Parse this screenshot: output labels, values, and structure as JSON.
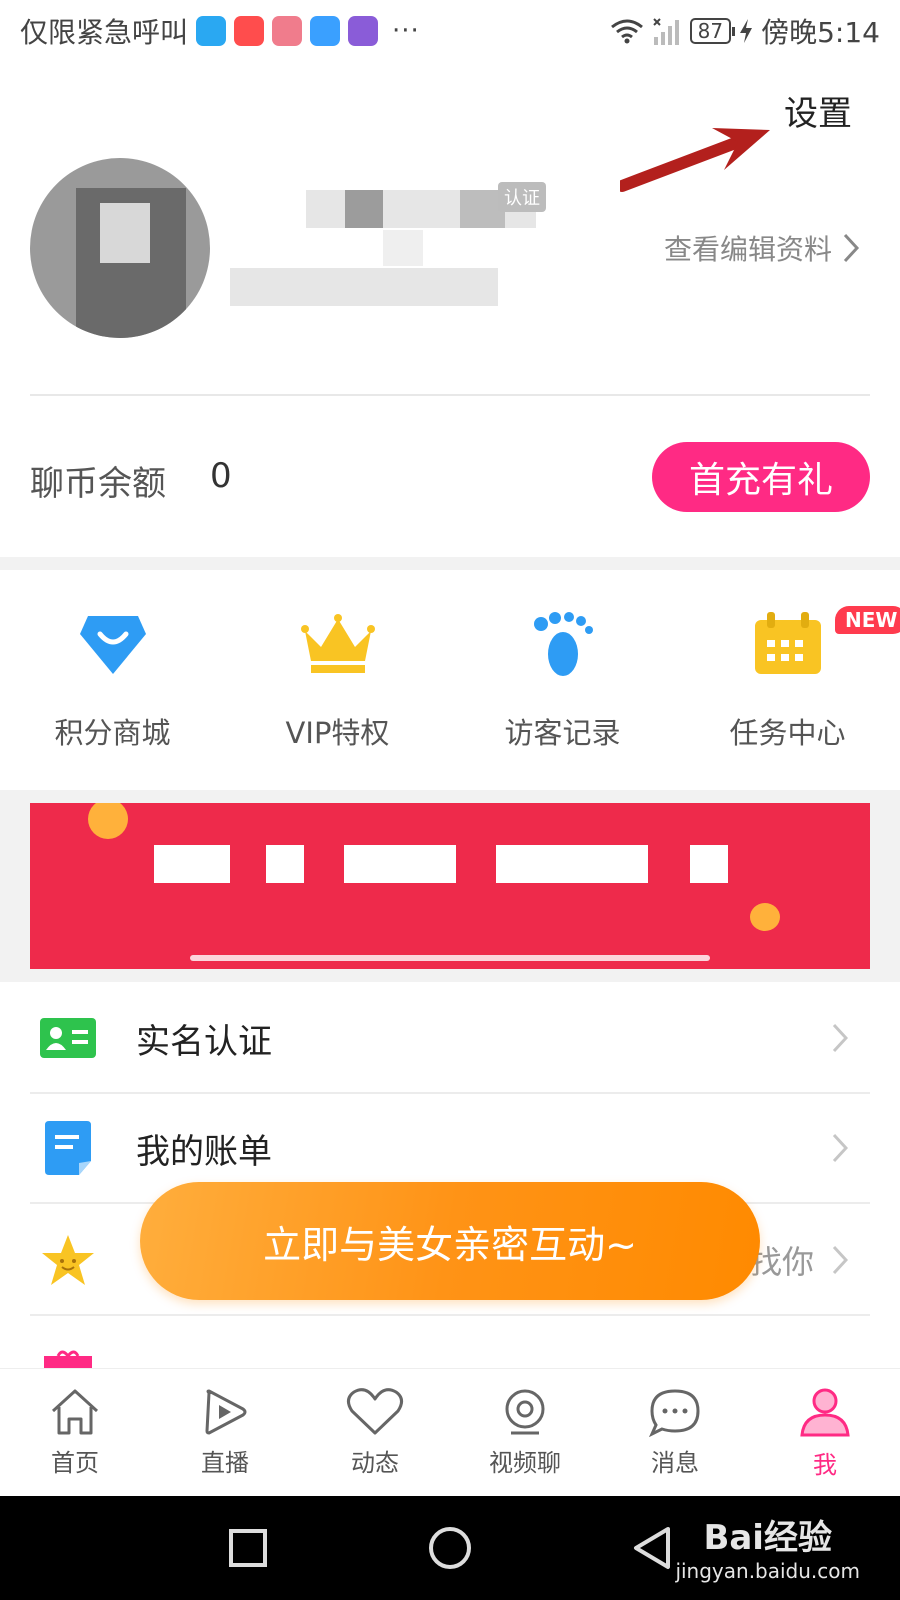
{
  "status_bar": {
    "carrier_text": "仅限紧急呼叫",
    "more": "···",
    "battery": "87",
    "time": "傍晚5:14",
    "app_colors": [
      "#2aa8f2",
      "#ff4d4d",
      "#f07c8c",
      "#3aa0ff",
      "#8a5cd8"
    ]
  },
  "header": {
    "settings_label": "设置",
    "verify_badge": "认证",
    "view_edit_label": "查看编辑资料"
  },
  "balance": {
    "label": "聊币余额",
    "value": "0",
    "recharge_button": "首充有礼"
  },
  "quick_menu": [
    {
      "label": "积分商城",
      "icon": "shop-bag-icon",
      "color": "#2e9cf4"
    },
    {
      "label": "VIP特权",
      "icon": "crown-icon",
      "color": "#f9c423"
    },
    {
      "label": "访客记录",
      "icon": "footprint-icon",
      "color": "#2e9cf4"
    },
    {
      "label": "任务中心",
      "icon": "calendar-icon",
      "color": "#f9c423",
      "badge": "NEW"
    }
  ],
  "list": [
    {
      "label": "实名认证",
      "icon": "id-card-icon",
      "color": "#2ec34d"
    },
    {
      "label": "我的账单",
      "icon": "bill-icon",
      "color": "#2e9cf4"
    },
    {
      "label": "",
      "right_text": "找你",
      "icon": "star-icon",
      "color": "#f9c423"
    },
    {
      "label": "",
      "icon": "gift-icon",
      "color": "#ff2a84"
    }
  ],
  "float_button": "立即与美女亲密互动~",
  "tabs": [
    {
      "label": "首页",
      "icon": "home-icon"
    },
    {
      "label": "直播",
      "icon": "play-icon"
    },
    {
      "label": "动态",
      "icon": "heart-icon"
    },
    {
      "label": "视频聊",
      "icon": "video-chat-icon"
    },
    {
      "label": "消息",
      "icon": "message-icon"
    },
    {
      "label": "我",
      "icon": "profile-icon",
      "active": true
    }
  ],
  "watermark": {
    "brand": "Bai经验",
    "url": "jingyan.baidu.com"
  },
  "colors": {
    "accent": "#ff2a84",
    "banner": "#ee2a4b",
    "float": "#ff9316"
  }
}
